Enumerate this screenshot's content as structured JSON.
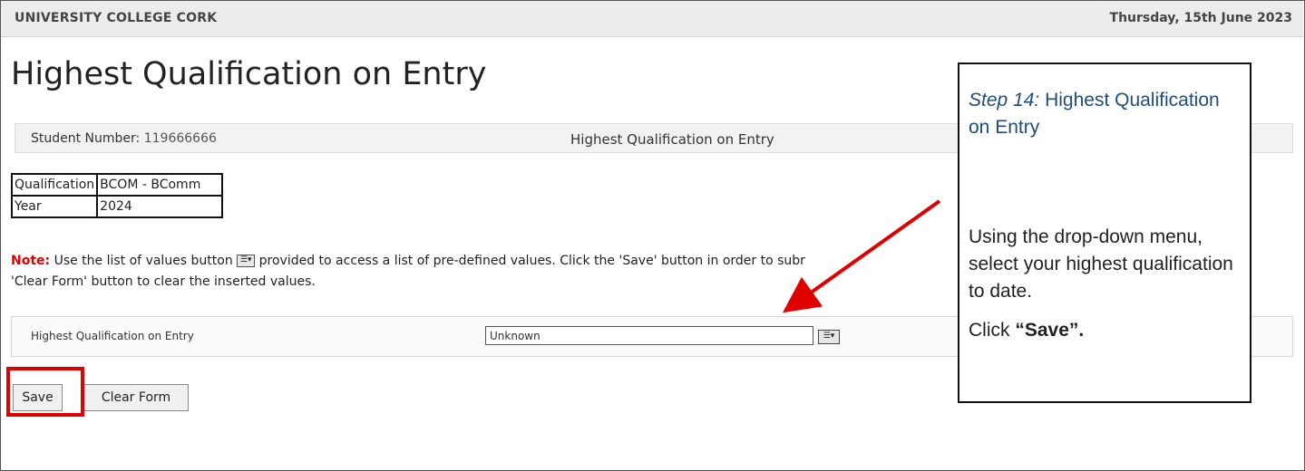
{
  "header": {
    "university": "UNIVERSITY COLLEGE CORK",
    "date": "Thursday, 15th June 2023"
  },
  "page": {
    "title": "Highest Qualification on Entry"
  },
  "info_bar": {
    "student_number_label": "Student Number:",
    "student_number_value": "119666666",
    "section_title": "Highest Qualification on Entry"
  },
  "summary_table": {
    "rows": [
      {
        "label": "Qualification",
        "value": "BCOM - BComm"
      },
      {
        "label": "Year",
        "value": "2024"
      }
    ]
  },
  "note": {
    "label": "Note:",
    "text_before_icon": "Use the list of values button",
    "text_after_icon": "provided to access a list of pre-defined values. Click the 'Save' button in order to subr",
    "line2": "'Clear Form' button to clear the inserted values."
  },
  "form": {
    "field_label": "Highest Qualification on Entry",
    "field_value": "Unknown"
  },
  "buttons": {
    "save": "Save",
    "clear": "Clear Form"
  },
  "callout": {
    "step": "Step 14:",
    "heading": "Highest Qualification on Entry",
    "body": "Using the drop-down menu, select your highest qualification to date.",
    "click_prefix": "Click",
    "click_target": "“Save”.",
    "heading_color": "#1f4e79"
  },
  "annotation_colors": {
    "highlight": "#e00000",
    "arrow": "#e00000"
  },
  "icons": {
    "list_of_values": "list-of-values-icon"
  }
}
